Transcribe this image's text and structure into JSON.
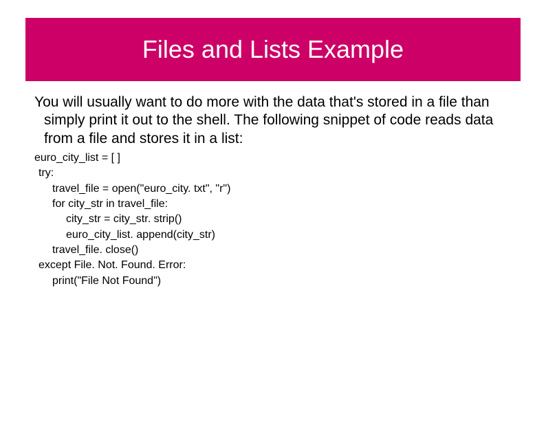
{
  "title": "Files and Lists Example",
  "intro": "You will usually want to do more with the data that's stored in a file than simply print it out to the shell.  The following snippet of code reads data from a file and stores it in a list:",
  "code": {
    "l0": "euro_city_list = [ ]",
    "l1": "try:",
    "l2": "travel_file = open(\"euro_city. txt\", \"r\")",
    "l3": "for city_str in travel_file:",
    "l4": "city_str = city_str. strip()",
    "l5": "euro_city_list. append(city_str)",
    "l6": "travel_file. close()",
    "l7": "except File. Not. Found. Error:",
    "l8": "print(\"File Not Found\")"
  }
}
